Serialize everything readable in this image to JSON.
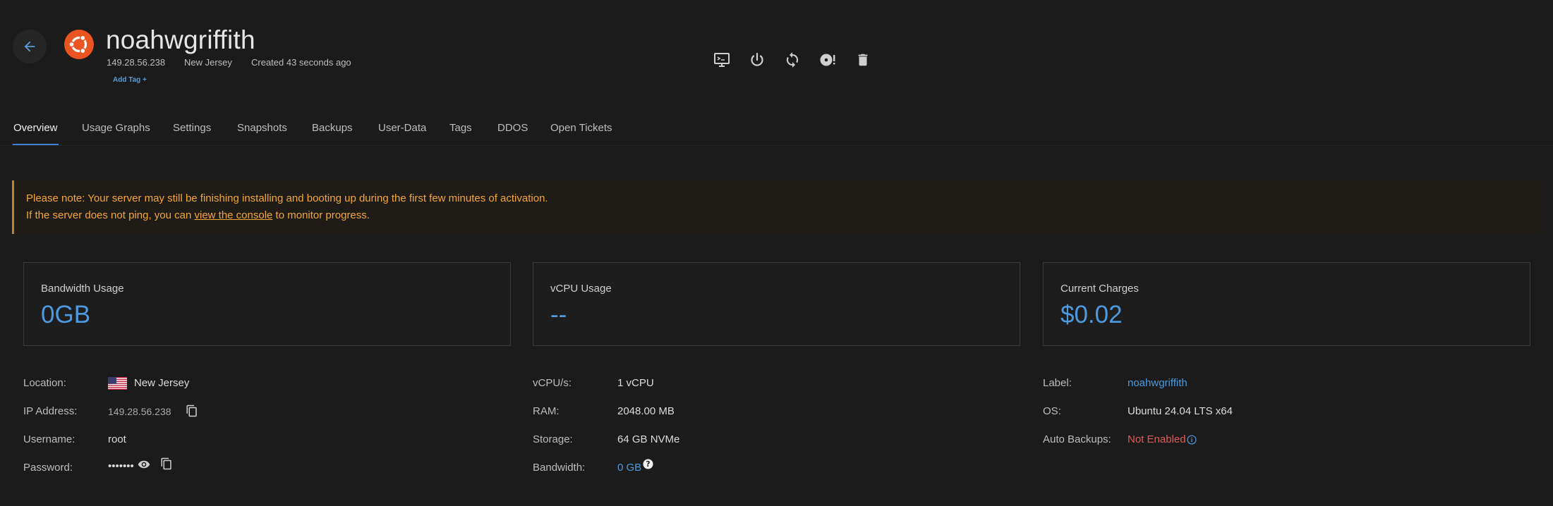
{
  "header": {
    "title": "noahwgriffith",
    "ip": "149.28.56.238",
    "location": "New Jersey",
    "created": "Created 43 seconds ago",
    "add_tag": "Add Tag +",
    "os_icon": "ubuntu-logo-icon",
    "back_icon": "arrow-left-icon",
    "toolbar": [
      {
        "name": "console-icon"
      },
      {
        "name": "power-icon"
      },
      {
        "name": "restart-icon"
      },
      {
        "name": "reinstall-icon"
      },
      {
        "name": "delete-icon"
      }
    ]
  },
  "tabs": [
    {
      "label": "Overview"
    },
    {
      "label": "Usage Graphs"
    },
    {
      "label": "Settings"
    },
    {
      "label": "Snapshots"
    },
    {
      "label": "Backups"
    },
    {
      "label": "User-Data"
    },
    {
      "label": "Tags"
    },
    {
      "label": "DDOS"
    },
    {
      "label": "Open Tickets"
    }
  ],
  "notice": {
    "line1": "Please note: Your server may still be finishing installing and booting up during the first few minutes of activation.",
    "line2_pre": "If the server does not ping, you can ",
    "line2_link": "view the console",
    "line2_post": " to monitor progress."
  },
  "cards": [
    {
      "label": "Bandwidth Usage",
      "value": "0GB"
    },
    {
      "label": "vCPU Usage",
      "value": "--"
    },
    {
      "label": "Current Charges",
      "value": "$0.02"
    }
  ],
  "details": {
    "col1": {
      "location_label": "Location:",
      "location_value": "New Jersey",
      "ip_label": "IP Address:",
      "ip_value": "149.28.56.238",
      "username_label": "Username:",
      "username_value": "root",
      "password_label": "Password:",
      "password_value": "•••••••"
    },
    "col2": {
      "vcpu_label": "vCPU/s:",
      "vcpu_value": "1 vCPU",
      "ram_label": "RAM:",
      "ram_value": "2048.00 MB",
      "storage_label": "Storage:",
      "storage_value": "64 GB NVMe",
      "bandwidth_label": "Bandwidth:",
      "bandwidth_value": "0 GB"
    },
    "col3": {
      "label_label": "Label:",
      "label_value": "noahwgriffith",
      "os_label": "OS:",
      "os_value": "Ubuntu 24.04 LTS x64",
      "backups_label": "Auto Backups:",
      "backups_value": "Not Enabled"
    }
  },
  "colors": {
    "accent": "#4d9ae0",
    "warning": "#f3a736",
    "danger": "#e05a5a",
    "ubuntu": "#e95420"
  }
}
